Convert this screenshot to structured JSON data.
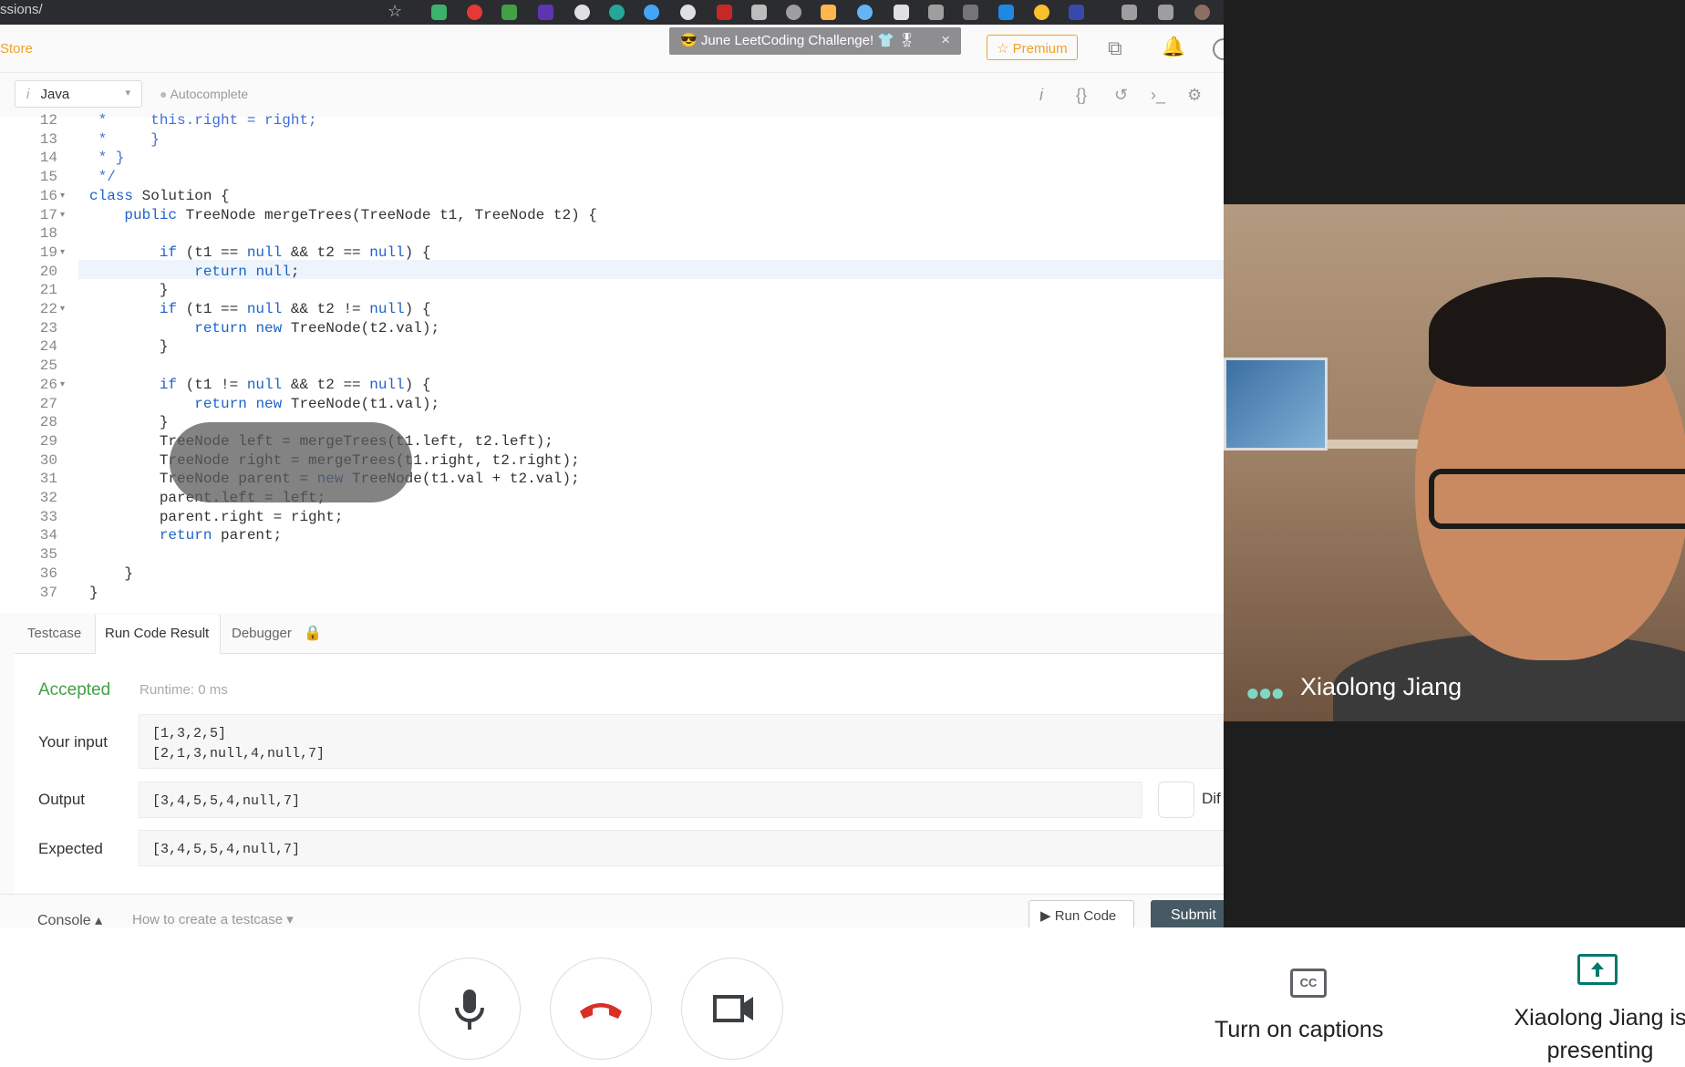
{
  "browser": {
    "url_fragment": "ssions/"
  },
  "leetcode": {
    "store_label": "Store",
    "challenge_banner": "😎 June LeetCoding Challenge! 👕 🎖",
    "premium_label": "☆ Premium",
    "language": "Java",
    "autocomplete_label": "Autocomplete",
    "code_lines": [
      {
        "n": "12",
        "fold": "",
        "text": " *     this.right = right;",
        "kind": "comment"
      },
      {
        "n": "13",
        "fold": "",
        "text": " *     }",
        "kind": "comment"
      },
      {
        "n": "14",
        "fold": "",
        "text": " * }",
        "kind": "comment"
      },
      {
        "n": "15",
        "fold": "",
        "text": " */",
        "kind": "comment"
      },
      {
        "n": "16",
        "fold": "▾",
        "text": "class Solution {",
        "kind": "code"
      },
      {
        "n": "17",
        "fold": "▾",
        "text": "    public TreeNode mergeTrees(TreeNode t1, TreeNode t2) {",
        "kind": "code"
      },
      {
        "n": "18",
        "fold": "",
        "text": "",
        "kind": "code"
      },
      {
        "n": "19",
        "fold": "▾",
        "text": "        if (t1 == null && t2 == null) {",
        "kind": "code"
      },
      {
        "n": "20",
        "fold": "",
        "text": "            return null;",
        "kind": "code"
      },
      {
        "n": "21",
        "fold": "",
        "text": "        }",
        "kind": "code"
      },
      {
        "n": "22",
        "fold": "▾",
        "text": "        if (t1 == null && t2 != null) {",
        "kind": "code"
      },
      {
        "n": "23",
        "fold": "",
        "text": "            return new TreeNode(t2.val);",
        "kind": "code"
      },
      {
        "n": "24",
        "fold": "",
        "text": "        }",
        "kind": "code"
      },
      {
        "n": "25",
        "fold": "",
        "text": "",
        "kind": "code"
      },
      {
        "n": "26",
        "fold": "▾",
        "text": "        if (t1 != null && t2 == null) {",
        "kind": "code"
      },
      {
        "n": "27",
        "fold": "",
        "text": "            return new TreeNode(t1.val);",
        "kind": "code"
      },
      {
        "n": "28",
        "fold": "",
        "text": "        }",
        "kind": "code"
      },
      {
        "n": "29",
        "fold": "",
        "text": "        TreeNode left = mergeTrees(t1.left, t2.left);",
        "kind": "code"
      },
      {
        "n": "30",
        "fold": "",
        "text": "        TreeNode right = mergeTrees(t1.right, t2.right);",
        "kind": "code"
      },
      {
        "n": "31",
        "fold": "",
        "text": "        TreeNode parent = new TreeNode(t1.val + t2.val);",
        "kind": "code"
      },
      {
        "n": "32",
        "fold": "",
        "text": "        parent.left = left;",
        "kind": "code"
      },
      {
        "n": "33",
        "fold": "",
        "text": "        parent.right = right;",
        "kind": "code"
      },
      {
        "n": "34",
        "fold": "",
        "text": "        return parent;",
        "kind": "code"
      },
      {
        "n": "35",
        "fold": "",
        "text": "",
        "kind": "code"
      },
      {
        "n": "36",
        "fold": "",
        "text": "    }",
        "kind": "code"
      },
      {
        "n": "37",
        "fold": "",
        "text": "}",
        "kind": "code"
      }
    ],
    "tabs": {
      "testcase": "Testcase",
      "result": "Run Code Result",
      "debugger": "Debugger"
    },
    "result": {
      "status": "Accepted",
      "runtime": "Runtime: 0 ms",
      "input_label": "Your input",
      "input_value": "[1,3,2,5]\n[2,1,3,null,4,null,7]",
      "output_label": "Output",
      "output_value": "[3,4,5,5,4,null,7]",
      "expected_label": "Expected",
      "expected_value": "[3,4,5,5,4,null,7]",
      "diff_label": "Dif"
    },
    "bottom": {
      "console_label": "Console ▴",
      "howto_label": "How to create a testcase ▾",
      "run_label": "▶ Run Code",
      "submit_label": "Submit"
    }
  },
  "meet": {
    "participant_name": "Xiaolong Jiang",
    "captions_label": "Turn on captions",
    "presenting_label": "Xiaolong Jiang is presenting",
    "colors": {
      "end_call": "#d93025",
      "present_accent": "#00796b"
    }
  }
}
